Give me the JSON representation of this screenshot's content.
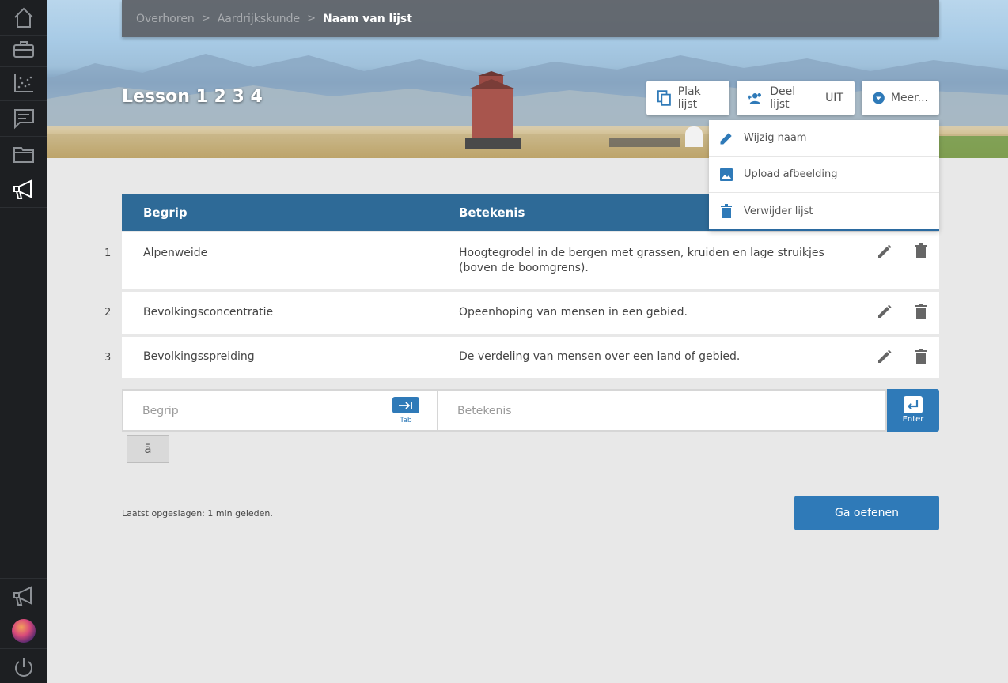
{
  "breadcrumb": {
    "items": [
      "Overhoren",
      "Aardrijkskunde"
    ],
    "current": "Naam van lijst"
  },
  "page": {
    "title": "Lesson 1 2 3 4"
  },
  "header_buttons": {
    "paste": "Plak lijst",
    "share": "Deel lijst",
    "share_state": "UIT",
    "more": "Meer..."
  },
  "dropdown": {
    "items": [
      {
        "label": "Wijzig naam",
        "icon": "pencil-icon"
      },
      {
        "label": "Upload afbeelding",
        "icon": "image-icon"
      },
      {
        "label": "Verwijder lijst",
        "icon": "trash-icon"
      }
    ]
  },
  "table": {
    "headers": {
      "term": "Begrip",
      "definition": "Betekenis"
    },
    "rows": [
      {
        "num": "1",
        "term": "Alpenweide",
        "definition": "Hoogtegrodel in de bergen met grassen, kruiden en lage struikjes (boven de boomgrens)."
      },
      {
        "num": "2",
        "term": "Bevolkingsconcentratie",
        "definition": "Opeenhoping van mensen in een gebied."
      },
      {
        "num": "3",
        "term": "Bevolkingsspreiding",
        "definition": "De verdeling van mensen over een land of gebied."
      }
    ]
  },
  "input": {
    "term_placeholder": "Begrip",
    "term_value": "",
    "definition_placeholder": "Betekenis",
    "definition_value": "",
    "tab_label": "Tab",
    "enter_label": "Enter"
  },
  "special_char": "ā",
  "footer": {
    "saved_text": "Laatst opgeslagen: 1 min geleden.",
    "practice_button": "Ga oefenen"
  },
  "colors": {
    "sidebar": "#1d1f22",
    "table_header": "#2e6a97",
    "accent": "#2f7ab8",
    "background": "#e8e8e8"
  }
}
